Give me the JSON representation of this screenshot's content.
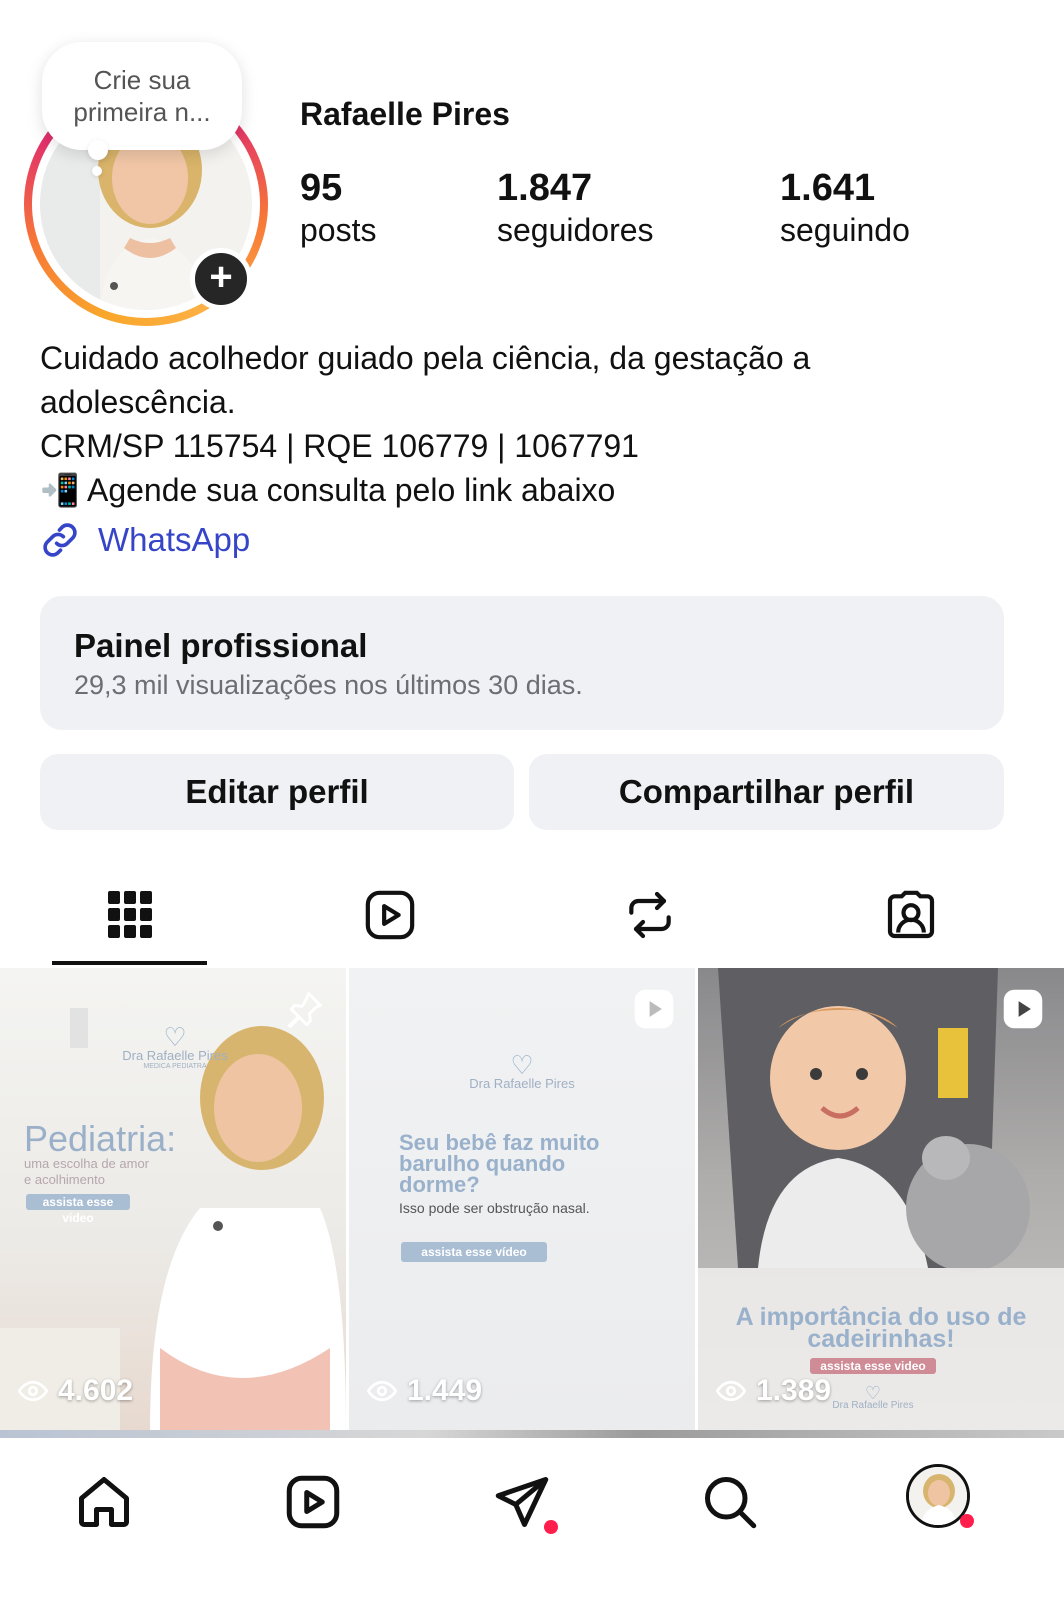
{
  "profile": {
    "note": "Crie sua primeira n...",
    "username": "Rafaelle Pires",
    "stats": {
      "posts": {
        "value": "95",
        "label": "posts"
      },
      "followers": {
        "value": "1.847",
        "label": "seguidores"
      },
      "following": {
        "value": "1.641",
        "label": "seguindo"
      }
    }
  },
  "bio": {
    "line1": "Cuidado acolhedor guiado pela ciência, da gestação a",
    "line2": "adolescência.",
    "line3": "CRM/SP 115754 | RQE 106779 | 1067791",
    "line4_emoji": "📲",
    "line4_text": "Agende sua consulta pelo link abaixo",
    "link_label": "WhatsApp"
  },
  "dashboard": {
    "title": "Painel profissional",
    "subtitle": "29,3 mil visualizações nos últimos 30 dias."
  },
  "actions": {
    "edit": "Editar perfil",
    "share": "Compartilhar perfil"
  },
  "tabs": [
    {
      "icon": "grid-icon",
      "active": true
    },
    {
      "icon": "reels-icon",
      "active": false
    },
    {
      "icon": "reposts-icon",
      "active": false
    },
    {
      "icon": "tagged-icon",
      "active": false
    }
  ],
  "posts": [
    {
      "views": "4.602",
      "pinned": true,
      "brand": "Dra Rafaelle Pires",
      "brand_sub": "MEDICA PEDIATRA",
      "headline": "Pediatria:",
      "subline1": "uma escolha de amor",
      "subline2": "e acolhimento",
      "cta": "assista esse video"
    },
    {
      "views": "1.449",
      "reel": true,
      "brand": "Dra Rafaelle Pires",
      "headline": "Seu bebê faz muito barulho quando dorme?",
      "subline": "Isso pode ser obstrução nasal.",
      "cta": "assista esse vídeo"
    },
    {
      "views": "1.389",
      "reel": true,
      "headline": "A importância do uso de cadeirinhas!",
      "cta": "assista esse video",
      "brand": "Dra Rafaelle Pires"
    }
  ],
  "colors": {
    "link": "#3645c8",
    "panel_bg": "#eff1f4",
    "notification": "#ff1e4c"
  },
  "bottom_nav": [
    "home-icon",
    "reels-icon",
    "messages-icon",
    "search-icon",
    "profile-avatar"
  ]
}
